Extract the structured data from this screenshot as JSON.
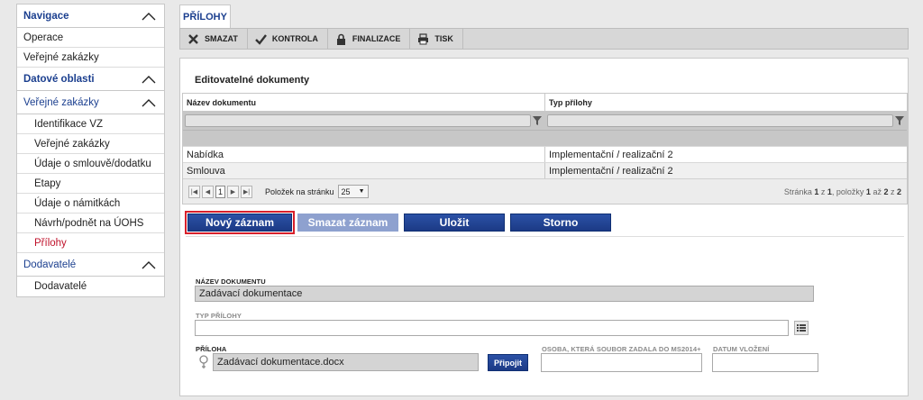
{
  "sidebar": {
    "navigace_header": "Navigace",
    "items_top": [
      "Operace",
      "Veřejné zakázky"
    ],
    "datove_oblasti_header": "Datové oblasti",
    "verejne_zakazky_header": "Veřejné zakázky",
    "sub_items": [
      "Identifikace VZ",
      "Veřejné zakázky",
      "Údaje o smlouvě/dodatku",
      "Etapy",
      "Údaje o námitkách",
      "Návrh/podnět na ÚOHS",
      "Přílohy"
    ],
    "dodavatele_header": "Dodavatelé",
    "dodavatele_items": [
      "Dodavatelé"
    ]
  },
  "tab": {
    "label": "PŘÍLOHY"
  },
  "toolbar": {
    "delete": "SMAZAT",
    "check": "KONTROLA",
    "finalize": "FINALIZACE",
    "print": "TISK"
  },
  "panel": {
    "title": "Editovatelné dokumenty",
    "columns": [
      "Název dokumentu",
      "Typ přílohy"
    ],
    "rows": [
      [
        "Nabídka",
        "Implementační / realizační 2"
      ],
      [
        "Smlouva",
        "Implementační / realizační 2"
      ]
    ],
    "pager": {
      "current_page": "1",
      "per_page_label": "Položek na stránku",
      "per_page_value": "25",
      "info_prefix": "Stránka ",
      "info_page": "1",
      "info_mid1": " z ",
      "info_total_pages": "1",
      "info_mid2": ", položky ",
      "info_from": "1",
      "info_mid3": " až ",
      "info_to": "2",
      "info_mid4": " z ",
      "info_total": "2"
    }
  },
  "actions": {
    "new": "Nový záznam",
    "delete": "Smazat záznam",
    "save": "Uložit",
    "cancel": "Storno"
  },
  "form": {
    "doc_name_label": "NÁZEV DOKUMENTU",
    "doc_name_value": "Zadávací dokumentace",
    "type_label": "TYP PŘÍLOHY",
    "type_value": "",
    "attachment_label": "PŘÍLOHA",
    "attachment_value": "Zadávací dokumentace.docx",
    "attach_button": "Připojit",
    "person_label": "OSOBA, KTERÁ SOUBOR ZADALA DO MS2014+",
    "person_value": "",
    "date_label": "DATUM VLOŽENÍ",
    "date_value": ""
  }
}
